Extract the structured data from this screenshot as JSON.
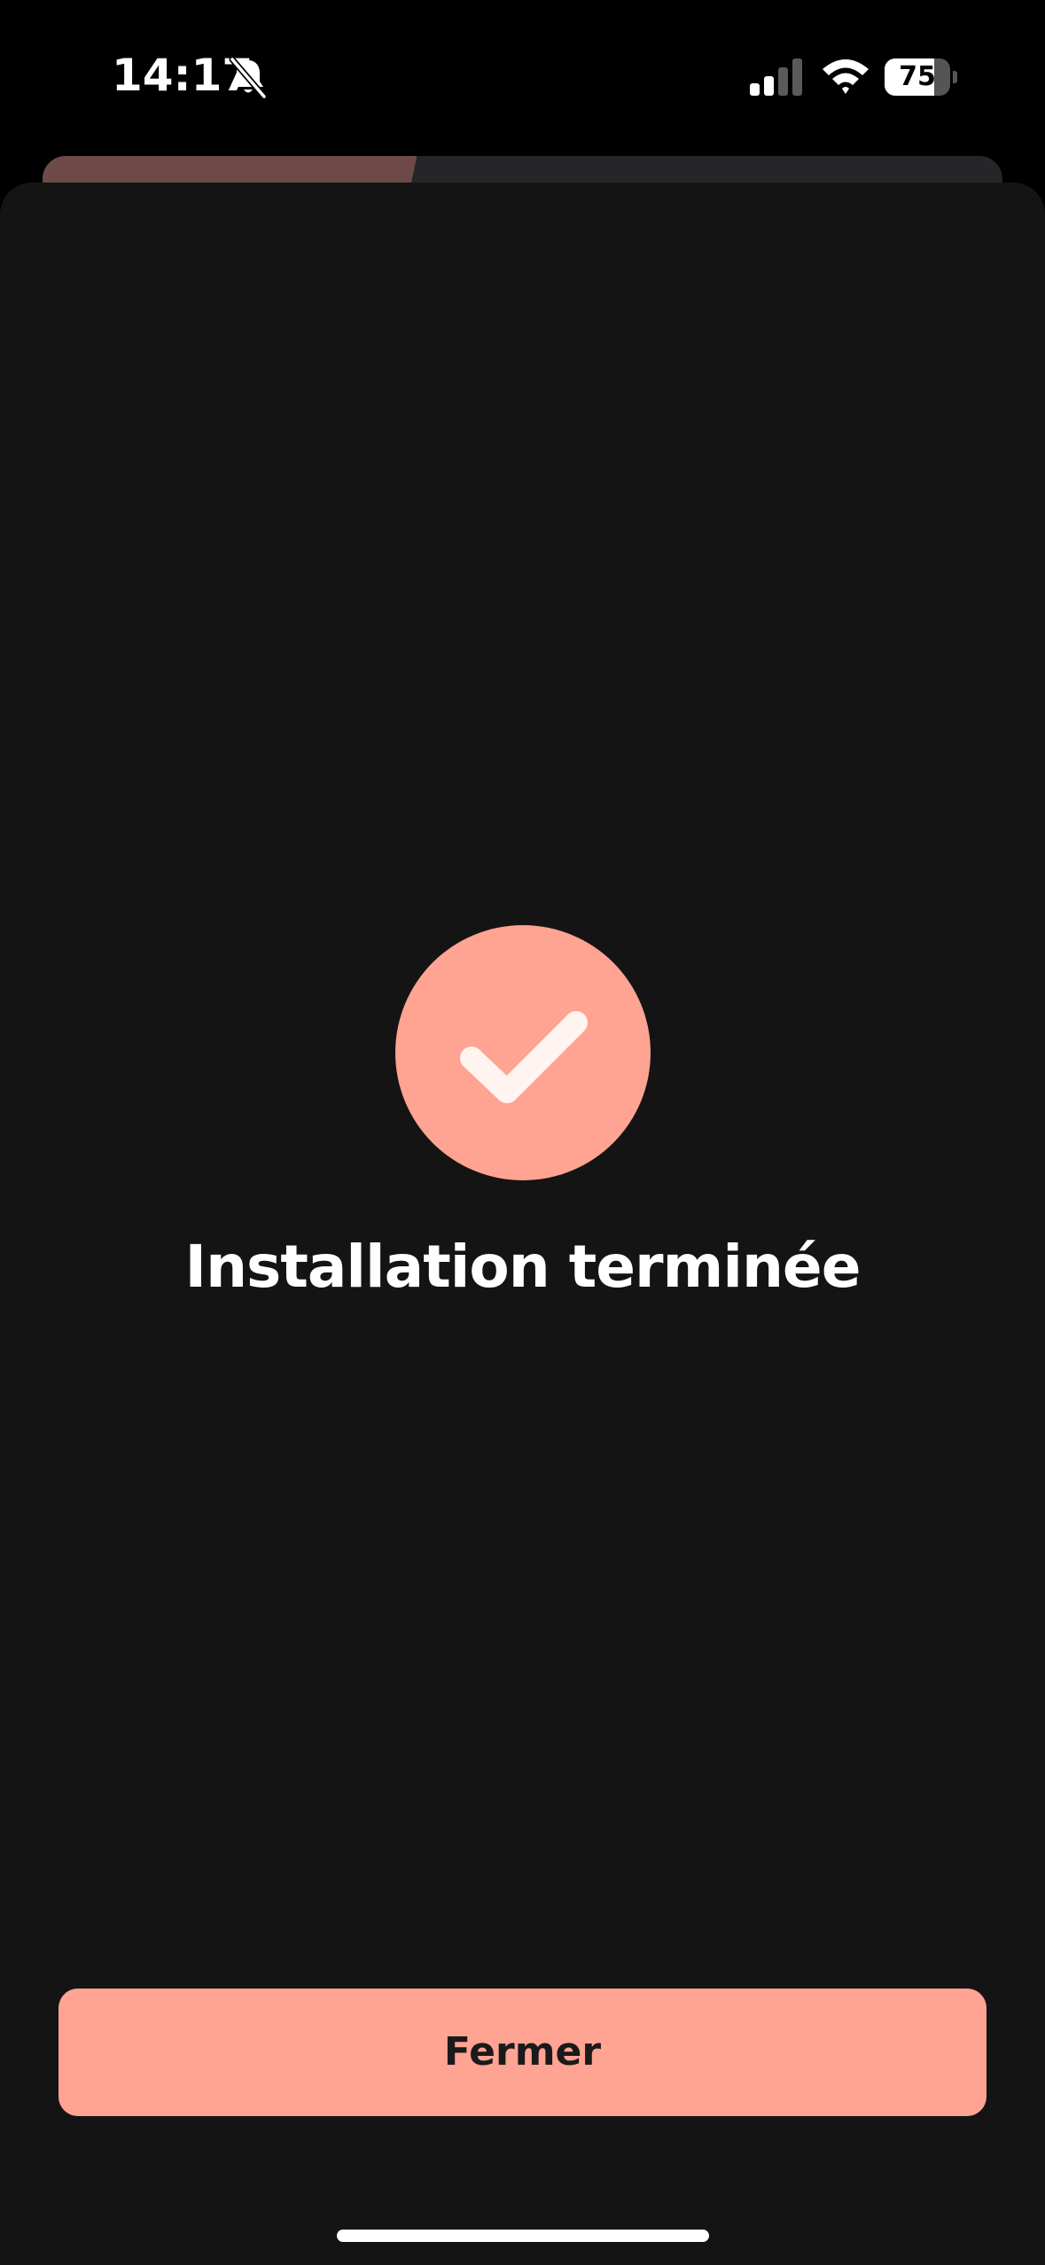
{
  "status_bar": {
    "time": "14:17",
    "battery_level": "75",
    "battery_fraction": 0.75,
    "silent_icon": "bell-slash-icon",
    "signal_icon": "cellular-signal-icon",
    "signal_bars_active": 2,
    "signal_bars_total": 4,
    "wifi_icon": "wifi-icon"
  },
  "background_card": {
    "progress_fraction": 0.39
  },
  "sheet": {
    "success_icon": "checkmark-icon",
    "title": "Installation terminée",
    "close_button_label": "Fermer"
  },
  "colors": {
    "accent": "#ffa392",
    "sheet_background": "#141414",
    "page_background": "#000000",
    "progress_fill": "#6d4a48"
  }
}
